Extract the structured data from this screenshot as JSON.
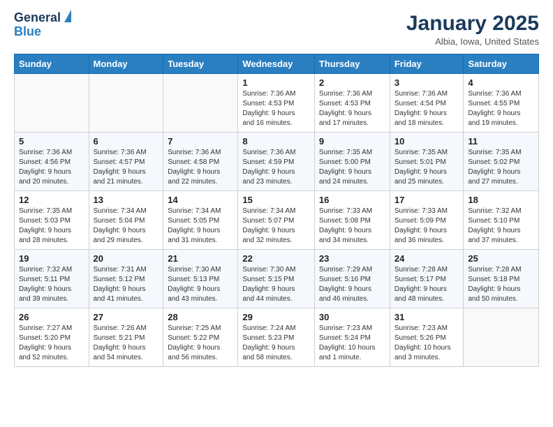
{
  "logo": {
    "line1": "General",
    "line2": "Blue"
  },
  "title": "January 2025",
  "subtitle": "Albia, Iowa, United States",
  "days_header": [
    "Sunday",
    "Monday",
    "Tuesday",
    "Wednesday",
    "Thursday",
    "Friday",
    "Saturday"
  ],
  "weeks": [
    [
      {
        "day": "",
        "info": ""
      },
      {
        "day": "",
        "info": ""
      },
      {
        "day": "",
        "info": ""
      },
      {
        "day": "1",
        "info": "Sunrise: 7:36 AM\nSunset: 4:53 PM\nDaylight: 9 hours\nand 16 minutes."
      },
      {
        "day": "2",
        "info": "Sunrise: 7:36 AM\nSunset: 4:53 PM\nDaylight: 9 hours\nand 17 minutes."
      },
      {
        "day": "3",
        "info": "Sunrise: 7:36 AM\nSunset: 4:54 PM\nDaylight: 9 hours\nand 18 minutes."
      },
      {
        "day": "4",
        "info": "Sunrise: 7:36 AM\nSunset: 4:55 PM\nDaylight: 9 hours\nand 19 minutes."
      }
    ],
    [
      {
        "day": "5",
        "info": "Sunrise: 7:36 AM\nSunset: 4:56 PM\nDaylight: 9 hours\nand 20 minutes."
      },
      {
        "day": "6",
        "info": "Sunrise: 7:36 AM\nSunset: 4:57 PM\nDaylight: 9 hours\nand 21 minutes."
      },
      {
        "day": "7",
        "info": "Sunrise: 7:36 AM\nSunset: 4:58 PM\nDaylight: 9 hours\nand 22 minutes."
      },
      {
        "day": "8",
        "info": "Sunrise: 7:36 AM\nSunset: 4:59 PM\nDaylight: 9 hours\nand 23 minutes."
      },
      {
        "day": "9",
        "info": "Sunrise: 7:35 AM\nSunset: 5:00 PM\nDaylight: 9 hours\nand 24 minutes."
      },
      {
        "day": "10",
        "info": "Sunrise: 7:35 AM\nSunset: 5:01 PM\nDaylight: 9 hours\nand 25 minutes."
      },
      {
        "day": "11",
        "info": "Sunrise: 7:35 AM\nSunset: 5:02 PM\nDaylight: 9 hours\nand 27 minutes."
      }
    ],
    [
      {
        "day": "12",
        "info": "Sunrise: 7:35 AM\nSunset: 5:03 PM\nDaylight: 9 hours\nand 28 minutes."
      },
      {
        "day": "13",
        "info": "Sunrise: 7:34 AM\nSunset: 5:04 PM\nDaylight: 9 hours\nand 29 minutes."
      },
      {
        "day": "14",
        "info": "Sunrise: 7:34 AM\nSunset: 5:05 PM\nDaylight: 9 hours\nand 31 minutes."
      },
      {
        "day": "15",
        "info": "Sunrise: 7:34 AM\nSunset: 5:07 PM\nDaylight: 9 hours\nand 32 minutes."
      },
      {
        "day": "16",
        "info": "Sunrise: 7:33 AM\nSunset: 5:08 PM\nDaylight: 9 hours\nand 34 minutes."
      },
      {
        "day": "17",
        "info": "Sunrise: 7:33 AM\nSunset: 5:09 PM\nDaylight: 9 hours\nand 36 minutes."
      },
      {
        "day": "18",
        "info": "Sunrise: 7:32 AM\nSunset: 5:10 PM\nDaylight: 9 hours\nand 37 minutes."
      }
    ],
    [
      {
        "day": "19",
        "info": "Sunrise: 7:32 AM\nSunset: 5:11 PM\nDaylight: 9 hours\nand 39 minutes."
      },
      {
        "day": "20",
        "info": "Sunrise: 7:31 AM\nSunset: 5:12 PM\nDaylight: 9 hours\nand 41 minutes."
      },
      {
        "day": "21",
        "info": "Sunrise: 7:30 AM\nSunset: 5:13 PM\nDaylight: 9 hours\nand 43 minutes."
      },
      {
        "day": "22",
        "info": "Sunrise: 7:30 AM\nSunset: 5:15 PM\nDaylight: 9 hours\nand 44 minutes."
      },
      {
        "day": "23",
        "info": "Sunrise: 7:29 AM\nSunset: 5:16 PM\nDaylight: 9 hours\nand 46 minutes."
      },
      {
        "day": "24",
        "info": "Sunrise: 7:28 AM\nSunset: 5:17 PM\nDaylight: 9 hours\nand 48 minutes."
      },
      {
        "day": "25",
        "info": "Sunrise: 7:28 AM\nSunset: 5:18 PM\nDaylight: 9 hours\nand 50 minutes."
      }
    ],
    [
      {
        "day": "26",
        "info": "Sunrise: 7:27 AM\nSunset: 5:20 PM\nDaylight: 9 hours\nand 52 minutes."
      },
      {
        "day": "27",
        "info": "Sunrise: 7:26 AM\nSunset: 5:21 PM\nDaylight: 9 hours\nand 54 minutes."
      },
      {
        "day": "28",
        "info": "Sunrise: 7:25 AM\nSunset: 5:22 PM\nDaylight: 9 hours\nand 56 minutes."
      },
      {
        "day": "29",
        "info": "Sunrise: 7:24 AM\nSunset: 5:23 PM\nDaylight: 9 hours\nand 58 minutes."
      },
      {
        "day": "30",
        "info": "Sunrise: 7:23 AM\nSunset: 5:24 PM\nDaylight: 10 hours\nand 1 minute."
      },
      {
        "day": "31",
        "info": "Sunrise: 7:23 AM\nSunset: 5:26 PM\nDaylight: 10 hours\nand 3 minutes."
      },
      {
        "day": "",
        "info": ""
      }
    ]
  ]
}
